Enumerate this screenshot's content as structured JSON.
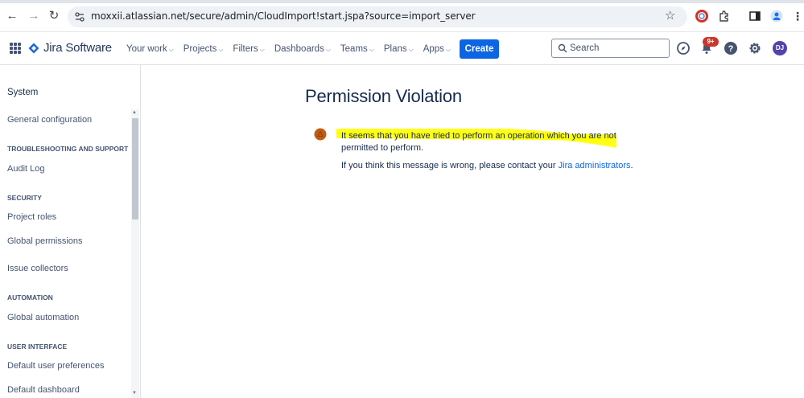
{
  "browser": {
    "url": "moxxii.atlassian.net/secure/admin/CloudImport!start.jspa?source=import_server"
  },
  "header": {
    "brand": "Jira Software",
    "menu": [
      {
        "label": "Your work"
      },
      {
        "label": "Projects"
      },
      {
        "label": "Filters"
      },
      {
        "label": "Dashboards"
      },
      {
        "label": "Teams"
      },
      {
        "label": "Plans"
      },
      {
        "label": "Apps"
      }
    ],
    "create_label": "Create",
    "search_placeholder": "Search",
    "notifications_badge": "9+",
    "avatar_initials": "DJ",
    "brand_color": "#0c66e4"
  },
  "sidebar": {
    "title": "System",
    "items": {
      "general_configuration": "General configuration",
      "troubleshooting_heading": "TROUBLESHOOTING AND SUPPORT",
      "audit_log": "Audit Log",
      "security_heading": "SECURITY",
      "project_roles": "Project roles",
      "global_permissions": "Global permissions",
      "issue_collectors": "Issue collectors",
      "automation_heading": "AUTOMATION",
      "global_automation": "Global automation",
      "user_interface_heading": "USER INTERFACE",
      "default_user_preferences": "Default user preferences",
      "default_dashboard": "Default dashboard"
    }
  },
  "main": {
    "title": "Permission Violation",
    "message": "It seems that you have tried to perform an operation which you are not permitted to perform.",
    "contact_prefix": "If you think this message is wrong, please contact your ",
    "contact_link": "Jira administrators",
    "contact_suffix": ".",
    "warning_color": "#c25b12",
    "highlight_color": "#ffff00"
  }
}
